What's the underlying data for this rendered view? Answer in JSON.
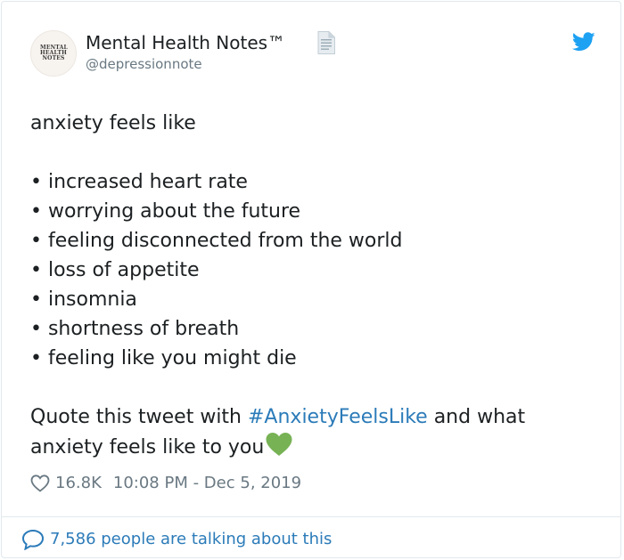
{
  "author": {
    "display_name": "Mental Health Notes™",
    "handle": "@depressionnote",
    "avatar_text": "MENTAL HEALTH NOTES",
    "avatar_icon": "avatar-logo",
    "badge_icon": "document-icon"
  },
  "brand": {
    "icon": "twitter-bird-icon",
    "color": "#1da1f2"
  },
  "tweet": {
    "intro": "anxiety feels like",
    "items": [
      "• increased heart rate",
      "• worrying about the future",
      "• feeling disconnected from the world",
      "• loss of appetite",
      "• insomnia",
      "• shortness of breath",
      "• feeling like you might die"
    ],
    "cta_prefix": "Quote this tweet with ",
    "hashtag": "#AnxietyFeelsLike",
    "cta_suffix": " and what",
    "cta_line2": "anxiety feels like to you",
    "emoji": "green-heart-emoji"
  },
  "meta": {
    "like_icon": "heart-outline-icon",
    "likes": "16.8K",
    "timestamp": "10:08 PM - Dec 5, 2019"
  },
  "footer": {
    "icon": "speech-bubble-icon",
    "text": "7,586 people are talking about this"
  },
  "colors": {
    "text": "#1c2022",
    "muted": "#697882",
    "link": "#2b7bb9",
    "border": "#e1e8ed",
    "emoji_green": "#77b255"
  }
}
